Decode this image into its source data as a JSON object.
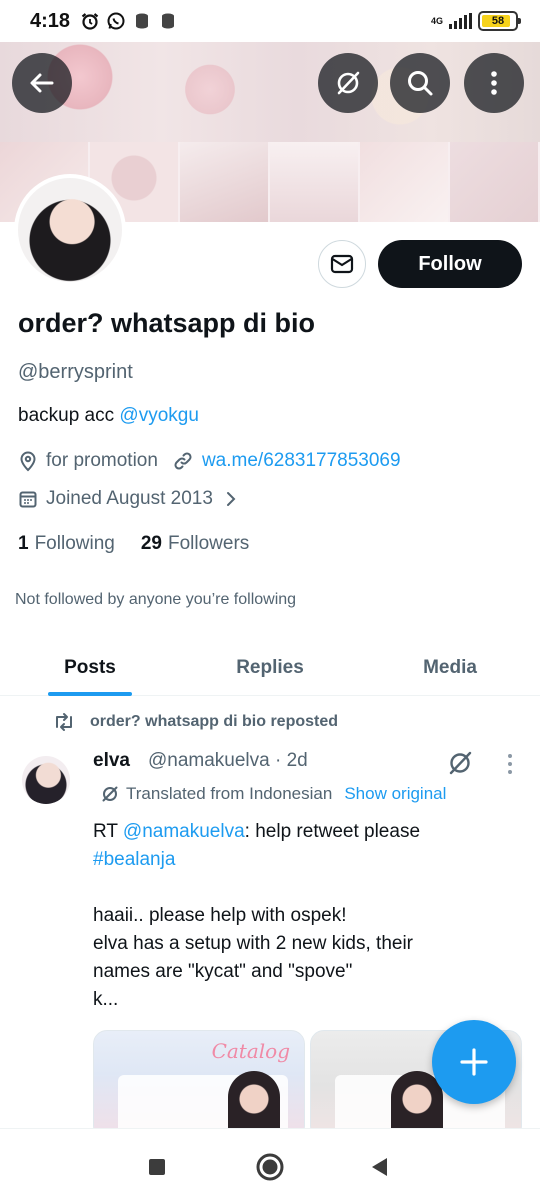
{
  "status_bar": {
    "time": "4:18",
    "network": "4G",
    "battery": "58"
  },
  "profile": {
    "display_name": "order? whatsapp di bio",
    "handle": "@berrysprint",
    "bio_prefix": "backup acc ",
    "bio_mention": "@vyokgu",
    "location": "for promotion",
    "website": "wa.me/6283177853069",
    "joined": "Joined August 2013",
    "following_count": "1",
    "following_label": "Following",
    "followers_count": "29",
    "followers_label": "Followers",
    "not_followed_note": "Not followed by anyone you’re following",
    "follow_button": "Follow"
  },
  "tabs": [
    {
      "label": "Posts",
      "active": true
    },
    {
      "label": "Replies",
      "active": false
    },
    {
      "label": "Media",
      "active": false
    }
  ],
  "post": {
    "repost_line": "order? whatsapp di bio reposted",
    "author_name": "elva",
    "author_handle_time": "@namakuelva · 2d",
    "translated_note": "Translated from Indonesian",
    "show_original": "Show original",
    "rt_prefix": "RT ",
    "rt_mention": "@namakuelva",
    "rt_text": ": help retweet please",
    "hashtag": "#bealanja",
    "line1": "haaii.. please help with ospek!",
    "line2": "elva has a setup with 2 new kids, their",
    "line3": "names are \"kycat\" and \"spove\"",
    "line4": "k..."
  },
  "media": {
    "label1": "Catalog"
  },
  "colors": {
    "accent": "#1d9bf0",
    "text": "#0f1419",
    "secondary": "#536471"
  }
}
